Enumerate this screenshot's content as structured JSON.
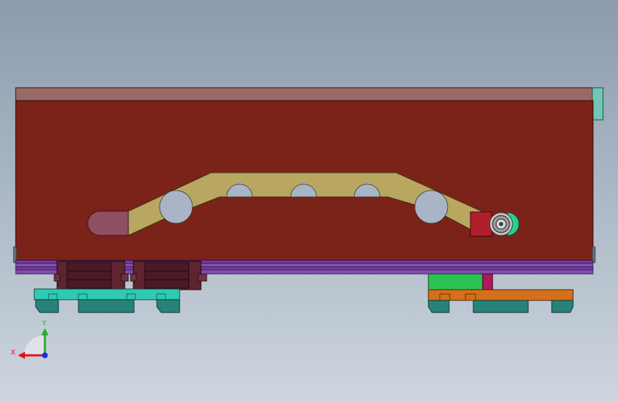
{
  "triad": {
    "x_label": "X",
    "y_label": "Y",
    "x_color": "#e0141e",
    "y_color": "#20b020",
    "z_color": "#1a2fe0"
  },
  "colors": {
    "top_plate": "#9b6a68",
    "main_body": "#7b2318",
    "cam_track": "#b8a661",
    "hole_fill": "#a9b4c6",
    "end_cap": "#8e5062",
    "follower_block": "#b01e2c",
    "roller_tip": "#2bd190",
    "side_tab": "#72c6b8",
    "rail_stripe": "#7a3ea6",
    "clamp": "#5e2430",
    "left_base": "#2ecab3",
    "left_feet": "#26827a",
    "right_green": "#2cc354",
    "right_base": "#d4701a",
    "right_feet": "#26827a",
    "magenta_tab": "#b0185e"
  }
}
